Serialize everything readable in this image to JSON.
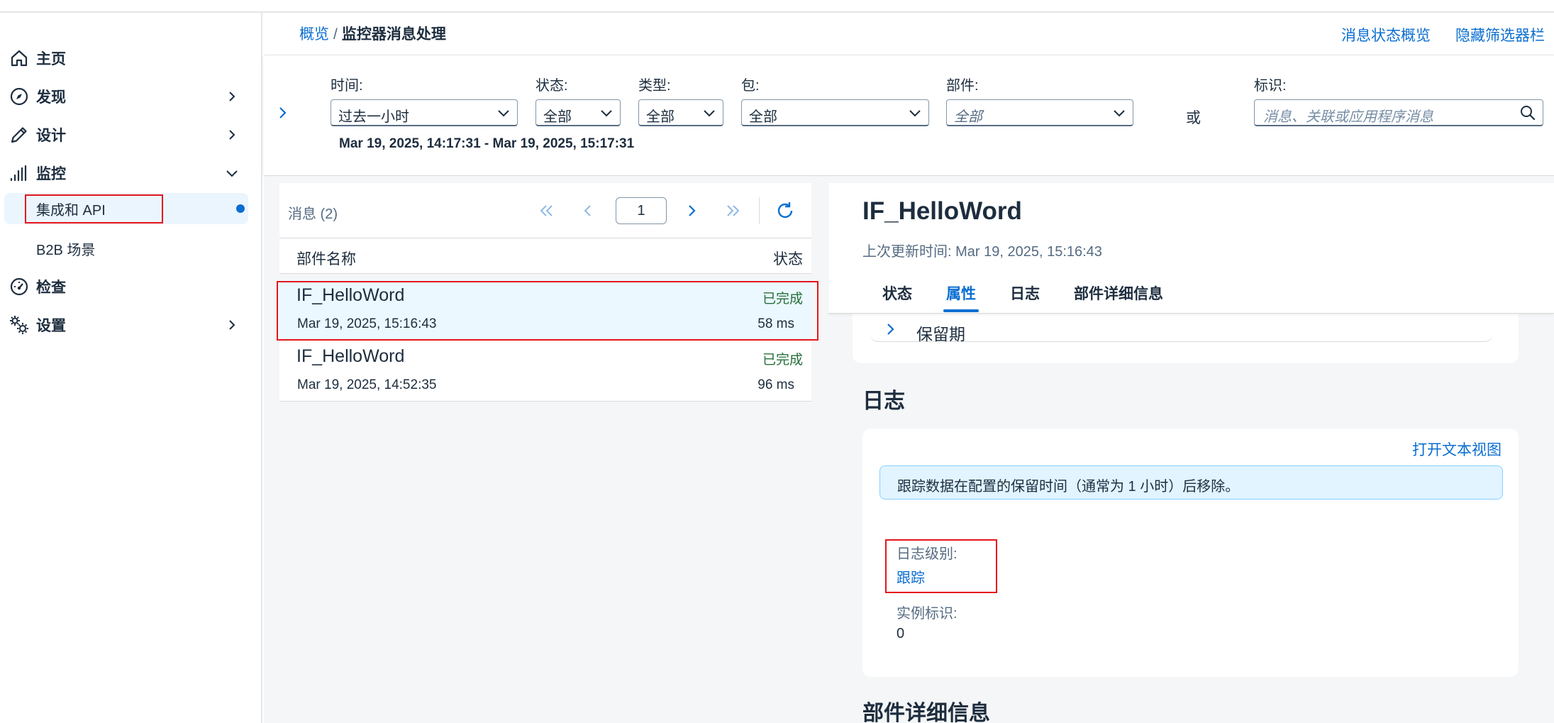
{
  "sidebar": {
    "items": [
      {
        "label": "主页",
        "icon": "home-icon"
      },
      {
        "label": "发现",
        "icon": "compass-icon"
      },
      {
        "label": "设计",
        "icon": "pencil-icon"
      },
      {
        "label": "监控",
        "icon": "monitor-bars-icon"
      },
      {
        "label": "检查",
        "icon": "gauge-icon"
      },
      {
        "label": "设置",
        "icon": "gears-icon"
      }
    ],
    "sub_items": [
      {
        "label": "集成和 API",
        "active": true
      },
      {
        "label": "B2B 场景",
        "active": false
      }
    ]
  },
  "header": {
    "breadcrumb_link": "概览",
    "breadcrumb_sep": "/",
    "breadcrumb_current": "监控器消息处理",
    "link_status_overview": "消息状态概览",
    "link_hide_filter": "隐藏筛选器栏"
  },
  "filters": {
    "time_label": "时间:",
    "time_value": "过去一小时",
    "status_label": "状态:",
    "status_value": "全部",
    "type_label": "类型:",
    "type_value": "全部",
    "package_label": "包:",
    "package_value": "全部",
    "artifact_label": "部件:",
    "artifact_value": "全部",
    "or_label": "或",
    "id_label": "标识:",
    "id_placeholder": "消息、关联或应用程序消息",
    "date_range": "Mar 19, 2025, 14:17:31 - Mar 19, 2025, 15:17:31"
  },
  "message_list": {
    "title": "消息 (2)",
    "page": "1",
    "col_name": "部件名称",
    "col_status": "状态",
    "rows": [
      {
        "name": "IF_HelloWord",
        "status": "已完成",
        "time": "Mar 19, 2025, 15:16:43",
        "duration": "58 ms",
        "selected": true
      },
      {
        "name": "IF_HelloWord",
        "status": "已完成",
        "time": "Mar 19, 2025, 14:52:35",
        "duration": "96 ms",
        "selected": false
      }
    ]
  },
  "detail": {
    "title": "IF_HelloWord",
    "last_updated": "上次更新时间: Mar 19, 2025, 15:16:43",
    "tabs": [
      "状态",
      "属性",
      "日志",
      "部件详细信息"
    ],
    "active_tab": "属性",
    "retention_label": "保留期",
    "log_section_title": "日志",
    "open_text_view": "打开文本视图",
    "info_text": "跟踪数据在配置的保留时间（通常为 1 小时）后移除。",
    "log_level_label": "日志级别:",
    "log_level_value": "跟踪",
    "instance_id_label": "实例标识:",
    "instance_id_value": "0",
    "artifact_section_title": "部件详细信息"
  },
  "colors": {
    "accent": "#0a6ed1",
    "success": "#256f3a",
    "highlight_box": "#e5161d",
    "selected_row": "#ebf8ff"
  }
}
